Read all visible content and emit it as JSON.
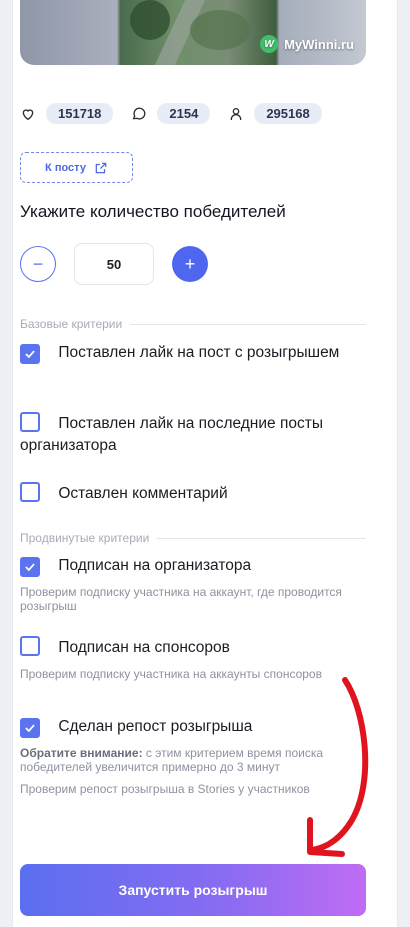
{
  "post": {
    "watermark": "MyWinni.ru",
    "logo_letter": "W"
  },
  "stats": {
    "likes": "151718",
    "comments": "2154",
    "followers": "295168",
    "icons": [
      "heart-icon",
      "comment-icon",
      "user-icon"
    ]
  },
  "to_post_label": "К посту",
  "winners": {
    "title": "Укажите количество победителей",
    "value": "50",
    "minus": "−",
    "plus": "+"
  },
  "basic": {
    "heading": "Базовые критерии",
    "items": [
      {
        "label": "Поставлен лайк на пост с розыгрышем",
        "checked": true
      },
      {
        "label": "Поставлен лайк на последние посты организатора",
        "checked": false
      },
      {
        "label": "Оставлен комментарий",
        "checked": false
      }
    ]
  },
  "advanced": {
    "heading": "Продвинутые критерии",
    "items": [
      {
        "label": "Подписан на организатора",
        "checked": true,
        "desc": "Проверим подписку участника на аккаунт, где проводится розыгрыш"
      },
      {
        "label": "Подписан на спонсоров",
        "checked": false,
        "desc": "Проверим подписку участника на аккаунты спонсоров"
      },
      {
        "label": "Сделан репост розыгрыша",
        "checked": true,
        "note_bold": "Обратите внимание:",
        "note": " с этим критерием время поиска победителей увеличится примерно до 3 минут",
        "desc": "Проверим репост розыгрыша в Stories у участников"
      }
    ]
  },
  "launch_label": "Запустить розыгрыш",
  "colors": {
    "accent": "#5b73ee",
    "arrow": "#e0141e",
    "button_gradient_start": "#5a6ef0",
    "button_gradient_end": "#c06cf4"
  }
}
